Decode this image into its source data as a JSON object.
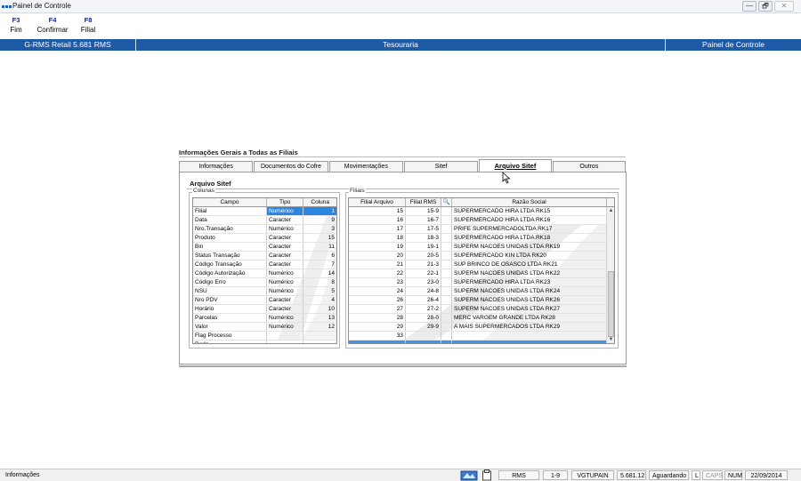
{
  "window": {
    "title": "Painel de Controle",
    "icon": "app-icon",
    "min_label": "—",
    "max_label": "🗗",
    "close_label": "✕"
  },
  "fkeys": [
    {
      "key": "F3",
      "label": "Fim"
    },
    {
      "key": "F4",
      "label": "Confirmar"
    },
    {
      "key": "F8",
      "label": "Filial"
    }
  ],
  "header": {
    "product": "G-RMS Retail 5.681 RMS",
    "module": "Tesouraria",
    "section": "Painel de Controle"
  },
  "panel": {
    "title": "Informações Gerais a Todas as Filiais",
    "tabs": [
      "Informações",
      "Documentos do Cofre",
      "Movimentações",
      "Sitef",
      "Arquivo  Sitef",
      "Outros"
    ],
    "active_tab": "Arquivo  Sitef",
    "section_title": "Arquivo Sitef",
    "colunas": {
      "legend": "Colunas",
      "headers": [
        "Campo",
        "Tipo",
        "Coluna"
      ],
      "rows": [
        [
          "Filial",
          "Numérico",
          "1"
        ],
        [
          "Data",
          "Caracter",
          "9"
        ],
        [
          "Nro.Transação",
          "Numérico",
          "3"
        ],
        [
          "Produto",
          "Caracter",
          "15"
        ],
        [
          "Bin",
          "Caracter",
          "11"
        ],
        [
          "Status Transação",
          "Caracter",
          "6"
        ],
        [
          "Código Transação",
          "Caracter",
          "7"
        ],
        [
          "Código Autorização",
          "Numérico",
          "14"
        ],
        [
          "Código Erro",
          "Numérico",
          "8"
        ],
        [
          "NSU",
          "Numérico",
          "5"
        ],
        [
          "Nro PDV",
          "Caracter",
          "4"
        ],
        [
          "Horário",
          "Caracter",
          "10"
        ],
        [
          "Parcelas",
          "Numérico",
          "13"
        ],
        [
          "Valor",
          "Numérico",
          "12"
        ],
        [
          "Flag Processo",
          "",
          ""
        ],
        [
          "Rede",
          "",
          ""
        ]
      ]
    },
    "filiais": {
      "legend": "Filiais",
      "headers": [
        "Filial Arquivo",
        "Filial RMS",
        "🔍",
        "Razão Social"
      ],
      "rows": [
        [
          "15",
          "15-9",
          "SUPERMERCADO HIRA LTDA RK15"
        ],
        [
          "16",
          "16-7",
          "SUPERMERCADO HIRA LTDA RK16"
        ],
        [
          "17",
          "17-5",
          "PRIFE SUPERMERCADOLTDA RK17"
        ],
        [
          "18",
          "18-3",
          "SUPERMERCADO HIRA LTDA RK18"
        ],
        [
          "19",
          "19-1",
          "SUPERM NACOES UNIDAS LTDA RK19"
        ],
        [
          "20",
          "20-5",
          "SUPERMERCADO KIN LTDA RK20"
        ],
        [
          "21",
          "21-3",
          "SUP BRINCO DE OSASCO LTDA RK21"
        ],
        [
          "22",
          "22-1",
          "SUPERM NACOES UNIDAS LTDA RK22"
        ],
        [
          "23",
          "23-0",
          "SUPERMERCADO HIRA LTDA RK23"
        ],
        [
          "24",
          "24-8",
          "SUPERM NACOES UNIDAS LTDA RK24"
        ],
        [
          "26",
          "26-4",
          "SUPERM NACOES UNIDAS LTDA RK26"
        ],
        [
          "27",
          "27-2",
          "SUPERM NACOES UNIDAS LTDA RK27"
        ],
        [
          "28",
          "28-0",
          "MERC VARGEM GRANDE LTDA RK28"
        ],
        [
          "29",
          "29-9",
          "A MAIS SUPERMERCADOS LTDA RK29"
        ],
        [
          "33",
          "",
          ""
        ],
        [
          "",
          "",
          ""
        ]
      ]
    }
  },
  "statusbar": {
    "left": "Informações",
    "items": [
      "RMS",
      "1-9",
      "VGTUPAIN",
      "5.681.12",
      "Aguardando",
      "L",
      "CAPS",
      "NUM",
      "22/09/2014"
    ]
  },
  "colors": {
    "header_blue": "#1f5aa6",
    "selection_blue": "#2b86e0"
  }
}
